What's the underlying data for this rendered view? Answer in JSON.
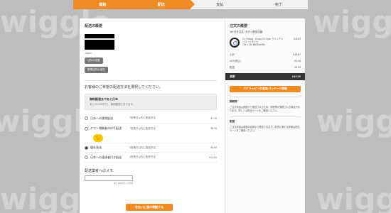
{
  "background_watermarks": [
    "wiggle",
    "wiggle",
    "wiggle",
    "wiggle",
    "wiggle",
    "wiggle"
  ],
  "progress": {
    "steps": [
      "開始",
      "配送",
      "支払",
      "完了"
    ],
    "active_step_count": 2
  },
  "delivery": {
    "section_title": "配送の概要",
    "country": "Japan",
    "change_address_button": "住所の変更",
    "add_address_button": "新規住所の追加"
  },
  "shipping": {
    "question": "お客様のご希望の配送方法を選択してください。",
    "notice_title": "無料配達まであと日本",
    "notice_sub": "あと¥X,XXX円で、無料配送となります。",
    "options": [
      {
        "name": "日本への通常配送",
        "eta": "7営業日以内に配送予定",
        "price": "¥7.49",
        "selected": false
      },
      {
        "name": "ヤマト運輸者市村手配送",
        "eta": "7営業日以内に配送予定",
        "price": "¥8.99",
        "selected": false
      },
      {
        "name": "優先発送",
        "eta": "3営業日以内に配送予定",
        "price": "¥9.99",
        "selected": true
      },
      {
        "name": "日本への速達者付き配送",
        "eta": "4営業日以内に配送予定",
        "price": "¥13.00",
        "selected": false
      }
    ],
    "memo_label": "配送業者へのメモ",
    "memo_note": "あと100文字入力可能",
    "submit_button": "支払いに進み確認する"
  },
  "order_summary": {
    "title": "注文の概要",
    "subtitle": "16+日を注文: 今すぐ配送可能",
    "item_desc": "1 x Vittoria - Corsa CX Open クリンチャーロードタイヤ",
    "item_variant": "700 x 23c Blk/Blue/Blk",
    "item_price": "£18.87",
    "rows": [
      {
        "label": "小計",
        "value": "£18.87"
      },
      {
        "label": "VAT(税込)",
        "value": "£3.06"
      },
      {
        "label": "配送",
        "value": "£9.99"
      }
    ],
    "total_label": "合計",
    "total_value": "£43.09",
    "packing_button": "パケラッピーの追加/パッケージ情報",
    "box1_title": "関税等",
    "box1_text": "ご注文商品は英国から発送されるため、関税等が課税される場合があります。詳しくは配送ページをご確認ください。",
    "box2_title": "配送",
    "box2_text": "ご注文商品は英国の倉庫から発送されます。配送に関する詳細は配送ページをご確認ください。"
  },
  "colors": {
    "accent": "#ef8b22",
    "background": "#bdbdbd",
    "total_bar": "#333333"
  }
}
